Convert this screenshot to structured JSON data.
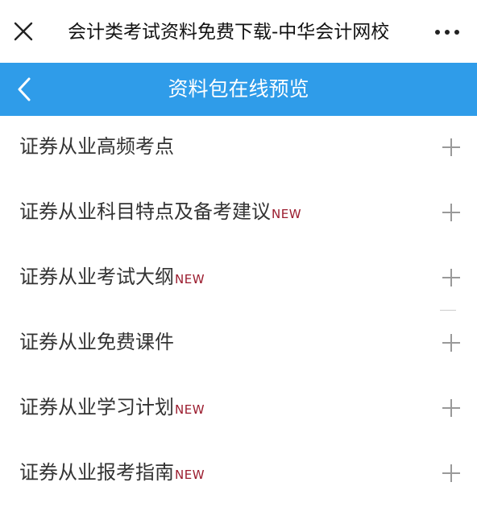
{
  "topbar": {
    "title": "会计类考试资料免费下载-中华会计网校",
    "close_icon": "close-icon",
    "more_icon": "more-dots-icon"
  },
  "header": {
    "title": "资料包在线预览",
    "back_icon": "chevron-left-icon",
    "bg_color": "#2f9ce9"
  },
  "items": [
    {
      "label": "证券从业高频考点",
      "badge": ""
    },
    {
      "label": "证券从业科目特点及备考建议",
      "badge": "NEW"
    },
    {
      "label": "证券从业考试大纲",
      "badge": "NEW"
    },
    {
      "label": "证券从业免费课件",
      "badge": ""
    },
    {
      "label": "证券从业学习计划",
      "badge": "NEW"
    },
    {
      "label": "证券从业报考指南",
      "badge": "NEW"
    }
  ],
  "colors": {
    "badge": "#9b1c2e",
    "text": "#333333",
    "plus": "#999999"
  }
}
